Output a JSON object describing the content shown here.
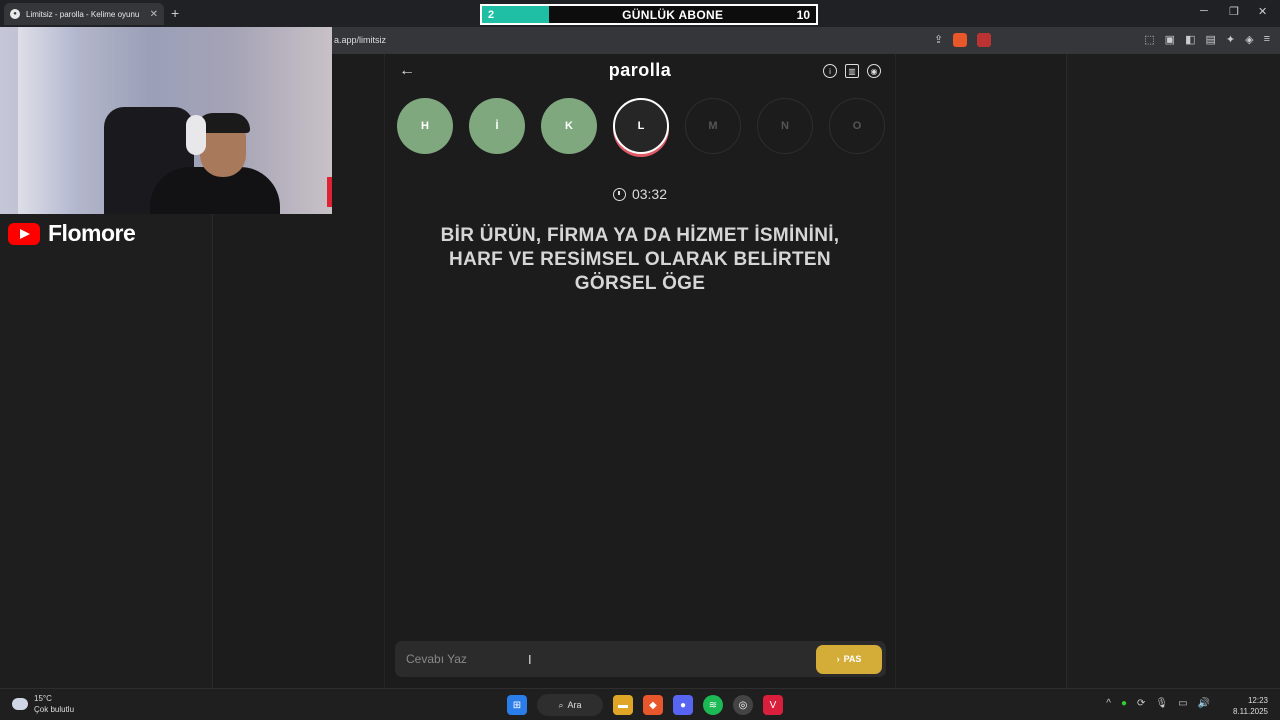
{
  "browser": {
    "tab_title": "Limitsiz - parolla - Kelime oyunu",
    "tab_close": "✕",
    "new_tab": "+",
    "url": "a.app/limitsiz",
    "window": {
      "minimize": "─",
      "restore": "❐",
      "close": "✕"
    }
  },
  "sub_counter": {
    "current": "2",
    "label": "GÜNLÜK ABONE",
    "goal": "10",
    "progress_fraction": 0.2,
    "accent": "#1fbfa6"
  },
  "streamer": {
    "channel_name": "Flomore",
    "platform_icon": "youtube-icon"
  },
  "game": {
    "title": "parolla",
    "back_icon": "←",
    "header_icons": [
      "info-icon",
      "stats-icon",
      "profile-icon"
    ],
    "letters": [
      {
        "char": "H",
        "state": "done"
      },
      {
        "char": "İ",
        "state": "done"
      },
      {
        "char": "K",
        "state": "done"
      },
      {
        "char": "L",
        "state": "active"
      },
      {
        "char": "M",
        "state": "pending"
      },
      {
        "char": "N",
        "state": "pending"
      },
      {
        "char": "O",
        "state": "pending"
      }
    ],
    "timer": "03:32",
    "question": "BİR ÜRÜN, FİRMA YA DA HİZMET İSMİNİNİ, HARF VE RESİMSEL OLARAK BELİRTEN GÖRSEL ÖGE",
    "answer_placeholder": "Cevabı Yaz",
    "pass_label": "PAS",
    "colors": {
      "done": "#7fa87f",
      "pass": "#d4ad38",
      "active_ring": "#e05a6a"
    }
  },
  "taskbar": {
    "weather_temp": "15°C",
    "weather_desc": "Çok bulutlu",
    "search_label": "Ara",
    "time": "12:23",
    "date": "8.11.2025"
  }
}
